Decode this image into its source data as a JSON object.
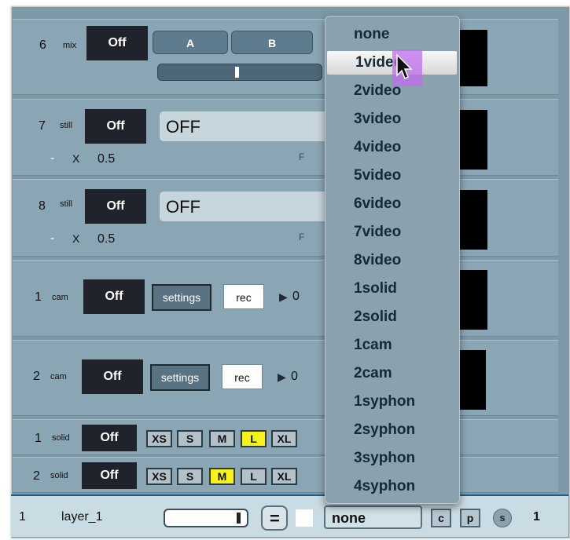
{
  "rows": {
    "r6": {
      "num": "6",
      "type": "mix",
      "off": "Off",
      "a": "A",
      "b": "B"
    },
    "r7": {
      "num": "7",
      "type": "still",
      "off": "Off",
      "field": "OFF",
      "minus": "-",
      "x": "X",
      "val": "0.5",
      "f": "F"
    },
    "r8": {
      "num": "8",
      "type": "still",
      "off": "Off",
      "field": "OFF",
      "minus": "-",
      "x": "X",
      "val": "0.5",
      "f": "F"
    },
    "cam1": {
      "num": "1",
      "type": "cam",
      "off": "Off",
      "settings": "settings",
      "rec": "rec",
      "count": "0"
    },
    "cam2": {
      "num": "2",
      "type": "cam",
      "off": "Off",
      "settings": "settings",
      "rec": "rec",
      "count": "0"
    },
    "solid1": {
      "num": "1",
      "type": "solid",
      "off": "Off",
      "sizes": [
        "XS",
        "S",
        "M",
        "L",
        "XL"
      ],
      "selected": "L"
    },
    "solid2": {
      "num": "2",
      "type": "solid",
      "off": "Off",
      "sizes": [
        "XS",
        "S",
        "M",
        "L",
        "XL"
      ],
      "selected": "M"
    }
  },
  "footer": {
    "num": "1",
    "layer": "layer_1",
    "eq": "=",
    "source": "none",
    "c": "c",
    "p": "p",
    "s": "s",
    "count": "1"
  },
  "dropdown": {
    "items": [
      "none",
      "1video",
      "2video",
      "3video",
      "4video",
      "5video",
      "6video",
      "7video",
      "8video",
      "1solid",
      "2solid",
      "1cam",
      "2cam",
      "1syphon",
      "2syphon",
      "3syphon",
      "4syphon"
    ],
    "selected": "1video"
  },
  "colors": {
    "highlight": "#f6f21b",
    "panel": "#8aa6b5",
    "offButton": "#20232b"
  }
}
